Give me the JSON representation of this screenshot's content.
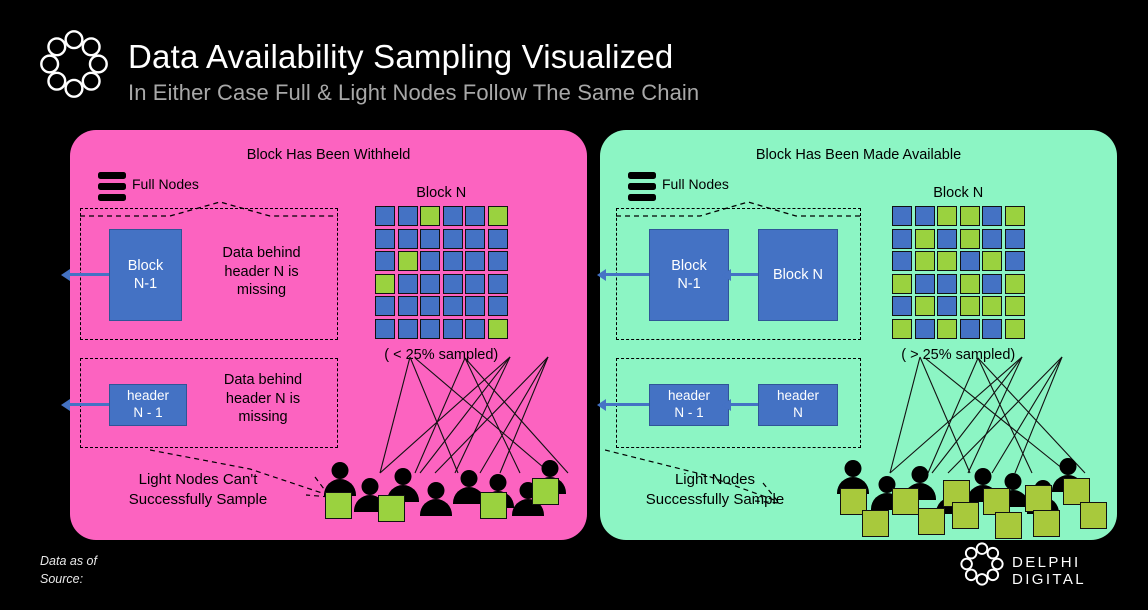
{
  "header": {
    "logo_icon": "delphi-ring-logo",
    "title": "Data Availability Sampling Visualized",
    "subtitle": "In Either Case Full & Light Nodes Follow The Same Chain"
  },
  "colors": {
    "background": "#000000",
    "panel_withheld": "#fc63c0",
    "panel_available": "#8cf5c4",
    "block_blue": "#4472c4",
    "sample_green": "#9ad23f",
    "title_text": "#ffffff",
    "subtitle_text": "#a8a8a8"
  },
  "panels": [
    {
      "id": "withheld",
      "title": "Block Has Been Withheld",
      "full_nodes_label": "Full Nodes",
      "full_nodes_icon": "stacked-bars-icon",
      "full_node_blocks": [
        {
          "line1": "Block",
          "line2": "N-1"
        }
      ],
      "full_node_note": [
        "Data behind",
        "header N is",
        "missing"
      ],
      "header_blocks": [
        {
          "line1": "header",
          "line2": "N - 1"
        }
      ],
      "header_note": [
        "Data behind",
        "header N is",
        "missing"
      ],
      "grid_title": "Block N",
      "grid_caption": "( < 25% sampled)",
      "grid": [
        [
          "b",
          "b",
          "g",
          "b",
          "b",
          "g"
        ],
        [
          "b",
          "b",
          "b",
          "b",
          "b",
          "b"
        ],
        [
          "b",
          "g",
          "b",
          "b",
          "b",
          "b"
        ],
        [
          "g",
          "b",
          "b",
          "b",
          "b",
          "b"
        ],
        [
          "b",
          "b",
          "b",
          "b",
          "b",
          "b"
        ],
        [
          "b",
          "b",
          "b",
          "b",
          "b",
          "g"
        ]
      ],
      "light_nodes_label": [
        "Light Nodes Can't",
        "Successfully Sample"
      ],
      "light_node_count": 9,
      "sample_square_count": 5
    },
    {
      "id": "available",
      "title": "Block Has Been Made Available",
      "full_nodes_label": "Full Nodes",
      "full_nodes_icon": "stacked-bars-icon",
      "full_node_blocks": [
        {
          "line1": "Block",
          "line2": "N-1"
        },
        {
          "line1": "Block N",
          "line2": ""
        }
      ],
      "full_node_note": [],
      "header_blocks": [
        {
          "line1": "header",
          "line2": "N - 1"
        },
        {
          "line1": "header",
          "line2": "N"
        }
      ],
      "header_note": [],
      "grid_title": "Block N",
      "grid_caption": "( > 25% sampled)",
      "grid": [
        [
          "b",
          "b",
          "g",
          "g",
          "b",
          "g"
        ],
        [
          "b",
          "g",
          "b",
          "g",
          "b",
          "b"
        ],
        [
          "b",
          "g",
          "g",
          "b",
          "g",
          "b"
        ],
        [
          "g",
          "b",
          "b",
          "g",
          "b",
          "g"
        ],
        [
          "b",
          "g",
          "b",
          "g",
          "g",
          "g"
        ],
        [
          "g",
          "b",
          "g",
          "b",
          "b",
          "g"
        ]
      ],
      "light_nodes_label": [
        "Light Nodes",
        "Successfully Sample"
      ],
      "light_node_count": 9,
      "sample_square_count": 13
    }
  ],
  "footer": {
    "data_as_of": "Data as of",
    "source": "Source:",
    "brand": "DELPHI DIGITAL",
    "brand_logo_icon": "delphi-ring-logo"
  }
}
